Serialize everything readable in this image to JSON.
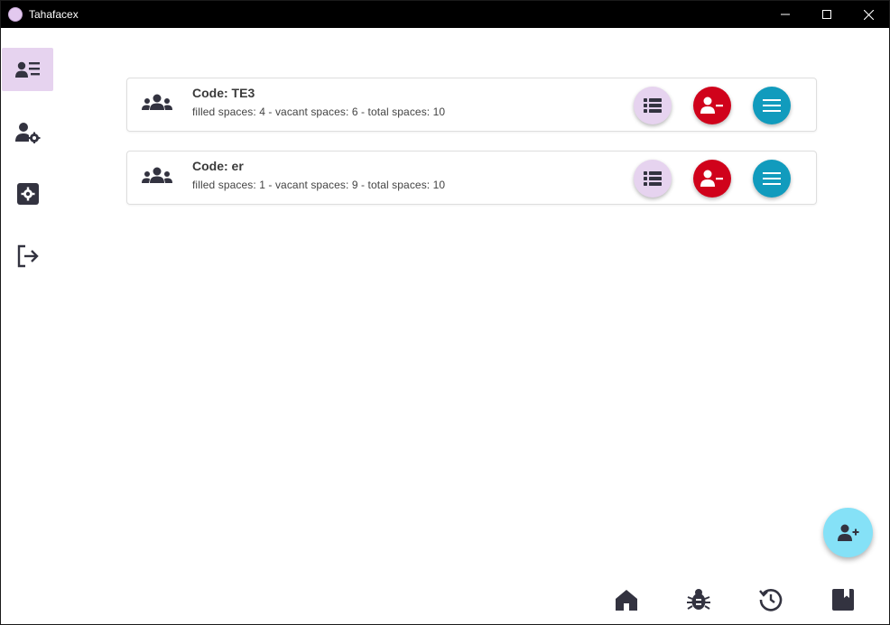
{
  "window": {
    "title": "Tahafacex",
    "controls": [
      "minimize-icon",
      "maximize-icon",
      "close-icon"
    ]
  },
  "sidebar": {
    "items": [
      {
        "icon": "contact-list-icon",
        "active": true
      },
      {
        "icon": "user-settings-icon",
        "active": false
      },
      {
        "icon": "settings-icon",
        "active": false
      },
      {
        "icon": "logout-icon",
        "active": false
      }
    ]
  },
  "groups": [
    {
      "code": "Code: TE3",
      "stats": "filled spaces: 4 - vacant spaces: 6 - total spaces: 10"
    },
    {
      "code": "Code: er",
      "stats": "filled spaces: 1 - vacant spaces: 9 - total spaces: 10"
    }
  ],
  "card_actions": [
    "list-icon",
    "remove-user-icon",
    "menu-icon"
  ],
  "fab": {
    "icon": "add-user-icon"
  },
  "bottom_nav": [
    "home-icon",
    "bug-icon",
    "history-icon",
    "bookmark-icon"
  ],
  "colors": {
    "accent_light": "#e6d3ef",
    "remove_red": "#d0021b",
    "menu_teal": "#119bbd",
    "fab_cyan": "#85e1f7",
    "icon_dark": "#333340"
  }
}
